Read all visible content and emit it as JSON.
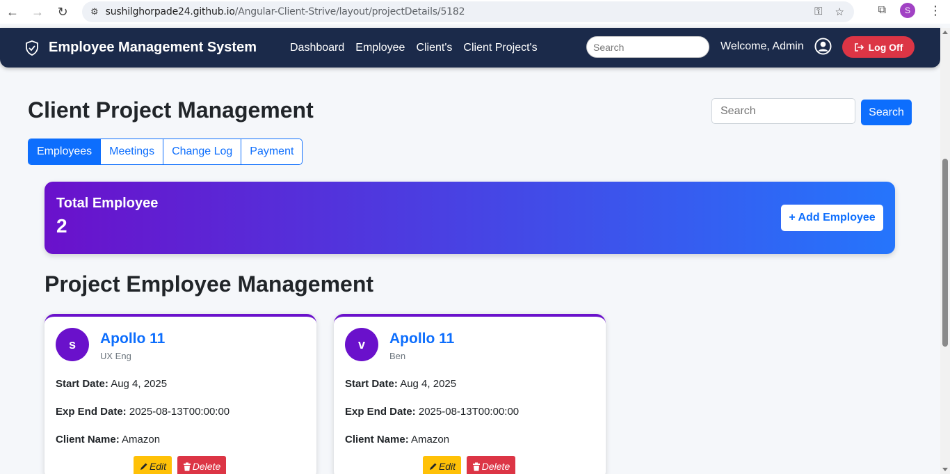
{
  "browser": {
    "url_host": "sushilghorpade24.github.io",
    "url_path": "/Angular-Client-Strive/layout/projectDetails/5182",
    "profile_initial": "S"
  },
  "navbar": {
    "brand": "Employee Management System",
    "links": [
      "Dashboard",
      "Employee",
      "Client's",
      "Client Project's"
    ],
    "search_placeholder": "Search",
    "welcome": "Welcome, Admin",
    "logoff": "Log Off"
  },
  "page": {
    "title": "Client Project Management",
    "search_placeholder": "Search",
    "search_button": "Search"
  },
  "tabs": [
    {
      "label": "Employees",
      "active": true
    },
    {
      "label": "Meetings",
      "active": false
    },
    {
      "label": "Change Log",
      "active": false
    },
    {
      "label": "Payment",
      "active": false
    }
  ],
  "summary": {
    "label": "Total Employee",
    "count": "2",
    "add_button": "+ Add Employee"
  },
  "section_title": "Project Employee Management",
  "field_labels": {
    "start": "Start Date:",
    "end": "Exp End Date:",
    "client": "Client Name:"
  },
  "actions": {
    "edit": "Edit",
    "delete": "Delete"
  },
  "cards": [
    {
      "initial": "s",
      "project": "Apollo 11",
      "role": "UX Eng",
      "start_date": "Aug 4, 2025",
      "end_date": "2025-08-13T00:00:00",
      "client": "Amazon"
    },
    {
      "initial": "v",
      "project": "Apollo 11",
      "role": "Ben",
      "start_date": "Aug 4, 2025",
      "end_date": "2025-08-13T00:00:00",
      "client": "Amazon"
    }
  ],
  "colors": {
    "navbar": "#1b2a4a",
    "primary": "#0d6efd",
    "danger": "#dc3545",
    "warning": "#ffc107",
    "gradient_start": "#6a11cb",
    "gradient_end": "#2575fc"
  }
}
